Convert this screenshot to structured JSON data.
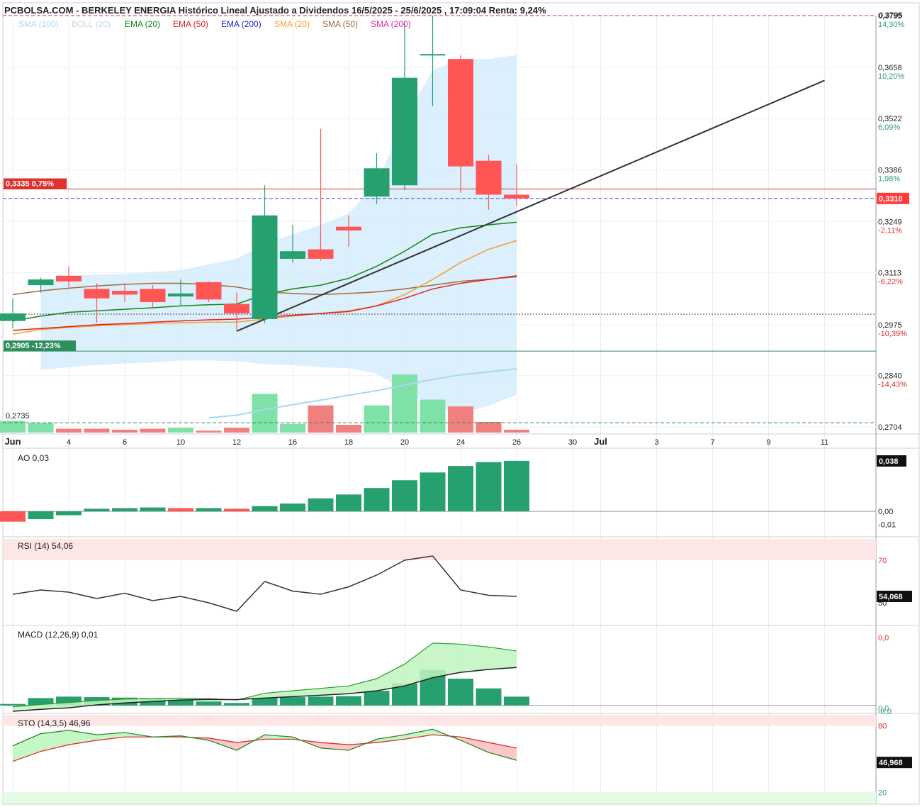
{
  "header": {
    "title": "PCBOLSA.COM - BERKELEY ENERGIA Histórico Lineal Ajustado a Dividendos 16/5/2025 - 25/6/2025 , 17:09:04 Renta: 9,24%",
    "top_tick_partial": "0,3795"
  },
  "legend": [
    {
      "label": "SMA (100)",
      "color": "#a8d8f0"
    },
    {
      "label": "BOLL (20)",
      "color": "#c8d8e8"
    },
    {
      "label": "EMA (20)",
      "color": "#118811"
    },
    {
      "label": "EMA (50)",
      "color": "#dd2222"
    },
    {
      "label": "EMA (200)",
      "color": "#2222cc"
    },
    {
      "label": "SMA (20)",
      "color": "#f0a030"
    },
    {
      "label": "SMA (50)",
      "color": "#a06a3a"
    },
    {
      "label": "SMA (200)",
      "color": "#ee22aa"
    }
  ],
  "colors": {
    "up": "#26a06e",
    "down": "#ff5555",
    "up_vol": "#7fe0a8",
    "down_vol": "#f08080",
    "trend": "#333333"
  },
  "chart_data": [
    {
      "type": "candlestick",
      "name": "price",
      "ylim": [
        0.2704,
        0.3795
      ],
      "y_ticks": [
        {
          "price": "0,3795",
          "pct": "14,30%",
          "v": 0.3795
        },
        {
          "price": "0,3658",
          "pct": "10,20%",
          "v": 0.3658
        },
        {
          "price": "0,3522",
          "pct": "6,09%",
          "v": 0.3522
        },
        {
          "price": "0,3386",
          "pct": "1,98%",
          "v": 0.3386
        },
        {
          "price": "0,3249",
          "pct": "-2,11%",
          "v": 0.3249
        },
        {
          "price": "0,3113",
          "pct": "-6,22%",
          "v": 0.3113
        },
        {
          "price": "0,2975",
          "pct": "-10,39%",
          "v": 0.2975
        },
        {
          "price": "0,2840",
          "pct": "-14,43%",
          "v": 0.284
        },
        {
          "price": "0,2704",
          "pct": "",
          "v": 0.2704
        }
      ],
      "x_ticks": [
        {
          "label": "30",
          "i": -1
        },
        {
          "label": "Jun",
          "i": 0
        },
        {
          "label": "4",
          "i": 2
        },
        {
          "label": "6",
          "i": 4
        },
        {
          "label": "10",
          "i": 6
        },
        {
          "label": "12",
          "i": 8
        },
        {
          "label": "16",
          "i": 10
        },
        {
          "label": "18",
          "i": 12
        },
        {
          "label": "20",
          "i": 14
        },
        {
          "label": "24",
          "i": 16
        },
        {
          "label": "26",
          "i": 18
        },
        {
          "label": "30",
          "i": 20
        },
        {
          "label": "Jul",
          "i": 21
        },
        {
          "label": "3",
          "i": 23
        },
        {
          "label": "7",
          "i": 25
        },
        {
          "label": "9",
          "i": 27
        },
        {
          "label": "11",
          "i": 29
        }
      ],
      "candles": [
        {
          "o": 0.2985,
          "h": 0.3045,
          "l": 0.2965,
          "c": 0.3005
        },
        {
          "o": 0.308,
          "h": 0.31,
          "l": 0.306,
          "c": 0.3095
        },
        {
          "o": 0.3105,
          "h": 0.313,
          "l": 0.3075,
          "c": 0.309
        },
        {
          "o": 0.307,
          "h": 0.3085,
          "l": 0.298,
          "c": 0.3045
        },
        {
          "o": 0.3065,
          "h": 0.3085,
          "l": 0.3035,
          "c": 0.3055
        },
        {
          "o": 0.307,
          "h": 0.308,
          "l": 0.302,
          "c": 0.3035
        },
        {
          "o": 0.305,
          "h": 0.3095,
          "l": 0.3025,
          "c": 0.3058
        },
        {
          "o": 0.3088,
          "h": 0.309,
          "l": 0.3035,
          "c": 0.3042
        },
        {
          "o": 0.303,
          "h": 0.306,
          "l": 0.296,
          "c": 0.3005
        },
        {
          "o": 0.299,
          "h": 0.3345,
          "l": 0.298,
          "c": 0.3265
        },
        {
          "o": 0.315,
          "h": 0.324,
          "l": 0.314,
          "c": 0.317
        },
        {
          "o": 0.3175,
          "h": 0.3495,
          "l": 0.3145,
          "c": 0.315
        },
        {
          "o": 0.3235,
          "h": 0.3265,
          "l": 0.3182,
          "c": 0.3225
        },
        {
          "o": 0.3315,
          "h": 0.343,
          "l": 0.3295,
          "c": 0.339
        },
        {
          "o": 0.3345,
          "h": 0.3775,
          "l": 0.3332,
          "c": 0.363
        },
        {
          "o": 0.369,
          "h": 0.3795,
          "l": 0.3555,
          "c": 0.3693
        },
        {
          "o": 0.368,
          "h": 0.369,
          "l": 0.3325,
          "c": 0.3395
        },
        {
          "o": 0.341,
          "h": 0.3425,
          "l": 0.328,
          "c": 0.332
        },
        {
          "o": 0.332,
          "h": 0.34,
          "l": 0.329,
          "c": 0.331
        }
      ],
      "volume": [
        12,
        10,
        4,
        4,
        3,
        4,
        5,
        2,
        5,
        40,
        9,
        28,
        8,
        28,
        60,
        34,
        27,
        11,
        3
      ],
      "sma100": [
        null,
        null,
        null,
        null,
        null,
        null,
        null,
        0.2728,
        0.2735,
        0.275,
        0.2763,
        0.2775,
        0.2788,
        0.28,
        0.2815,
        0.283,
        0.2842,
        0.285,
        0.2858
      ],
      "ema20": [
        0.2985,
        0.2998,
        0.3008,
        0.3012,
        0.3016,
        0.302,
        0.3025,
        0.3028,
        0.303,
        0.3055,
        0.307,
        0.308,
        0.3098,
        0.313,
        0.317,
        0.3215,
        0.3232,
        0.324,
        0.3247
      ],
      "ema50": [
        0.296,
        0.2965,
        0.297,
        0.2975,
        0.2978,
        0.2982,
        0.2985,
        0.2988,
        0.299,
        0.2995,
        0.3,
        0.3005,
        0.301,
        0.3025,
        0.3045,
        0.307,
        0.3085,
        0.3095,
        0.3105
      ],
      "sma20": [
        0.295,
        0.2962,
        0.2968,
        0.2972,
        0.2975,
        0.2978,
        0.298,
        0.2982,
        0.2982,
        0.299,
        0.2998,
        0.3005,
        0.3012,
        0.3025,
        0.3055,
        0.3095,
        0.314,
        0.3175,
        0.3198
      ],
      "sma50": [
        0.3055,
        0.3065,
        0.3072,
        0.3078,
        0.3082,
        0.3085,
        0.3085,
        0.3082,
        0.3075,
        0.3062,
        0.3058,
        0.3055,
        0.3058,
        0.3062,
        0.307,
        0.308,
        0.309,
        0.3096,
        0.3102
      ],
      "boll_upper": [
        null,
        0.309,
        0.3105,
        0.3108,
        0.311,
        0.3115,
        0.312,
        0.3135,
        0.315,
        0.319,
        0.3215,
        0.324,
        0.327,
        0.335,
        0.352,
        0.365,
        0.368,
        0.368,
        0.369
      ],
      "boll_lower": [
        null,
        0.2855,
        0.2862,
        0.2868,
        0.2872,
        0.2875,
        0.288,
        0.288,
        0.2878,
        0.287,
        0.2868,
        0.2862,
        0.286,
        0.2845,
        0.28,
        0.276,
        0.274,
        0.276,
        0.279
      ],
      "trendline": {
        "from": {
          "i": 8,
          "v": 0.2958
        },
        "to": {
          "i": 29,
          "v": 0.3623
        }
      },
      "price_lines": [
        {
          "value": 0.3335,
          "label": "0,3335  0,75%",
          "color": "#e03030"
        },
        {
          "value": 0.331,
          "label": "0,3310",
          "color": "#2244dd",
          "style": "dashed"
        },
        {
          "value": 0.3003,
          "color": "#444444",
          "style": "dotted"
        },
        {
          "value": 0.2905,
          "label": "0,2905  -12,23%",
          "color": "#2f8f5f"
        },
        {
          "value": 0.2715,
          "color": "#2f8f5f",
          "style": "dashed"
        },
        {
          "value": 0.3795,
          "color": "#e03030",
          "style": "dashed"
        }
      ],
      "low_label": "0,2735",
      "last_price_badge": "0,3310"
    },
    {
      "type": "bar",
      "name": "AO",
      "title": "AO   0,03",
      "ylim": [
        -0.012,
        0.04
      ],
      "y_ticks": [
        {
          "label": "0,00",
          "v": 0.0
        },
        {
          "label": "-0,01",
          "v": -0.01
        }
      ],
      "last_badge": "0,038",
      "values": [
        -0.008,
        -0.006,
        -0.003,
        0.002,
        0.0025,
        0.003,
        0.0025,
        0.0025,
        0.002,
        0.004,
        0.006,
        0.01,
        0.013,
        0.018,
        0.024,
        0.03,
        0.035,
        0.038,
        0.039
      ],
      "colors": [
        "down",
        "up",
        "up",
        "up",
        "up",
        "up",
        "down",
        "up",
        "down",
        "up",
        "up",
        "up",
        "up",
        "up",
        "up",
        "up",
        "up",
        "up",
        "up"
      ]
    },
    {
      "type": "line",
      "name": "RSI",
      "title": "RSI (14)   54,06",
      "ylim": [
        40,
        80
      ],
      "band_from": 70,
      "y_ticks": [
        {
          "label": "70",
          "v": 70
        },
        {
          "label": "50",
          "v": 50
        }
      ],
      "last_badge": "54,068",
      "values": [
        54,
        56,
        55,
        52,
        54.5,
        51,
        53,
        50,
        46,
        60,
        55.5,
        54,
        57.5,
        63,
        70,
        72,
        56,
        53.5,
        53
      ]
    },
    {
      "type": "bar",
      "name": "MACD",
      "title": "MACD (12,26,9)   0,01",
      "ylim": [
        -0.0015,
        0.016
      ],
      "y_ticks": [
        {
          "label": "0,0",
          "v": 0.0
        },
        {
          "label": "-0,0",
          "v": -0.0006
        }
      ],
      "top_label": "0,0",
      "histogram": [
        0.0003,
        0.0015,
        0.0018,
        0.0017,
        0.0016,
        0.0015,
        0.0013,
        0.0008,
        0.0005,
        0.0015,
        0.0017,
        0.0018,
        0.0019,
        0.003,
        0.0045,
        0.0073,
        0.0055,
        0.0035,
        0.0018
      ],
      "macd": [
        -0.0003,
        0.0002,
        0.0006,
        0.001,
        0.0013,
        0.0014,
        0.0015,
        0.0014,
        0.0011,
        0.0025,
        0.003,
        0.0035,
        0.004,
        0.0055,
        0.0085,
        0.0128,
        0.0126,
        0.012,
        0.0112
      ],
      "signal": [
        -0.0012,
        -0.0008,
        -0.0005,
        0.0001,
        0.0005,
        0.0008,
        0.0011,
        0.0012,
        0.0012,
        0.0015,
        0.0018,
        0.0021,
        0.0024,
        0.003,
        0.004,
        0.0057,
        0.0068,
        0.0074,
        0.0078
      ]
    },
    {
      "type": "line",
      "name": "STO",
      "title": "STO (14,3,5)   46,96",
      "ylim": [
        10,
        90
      ],
      "band_top_from": 80,
      "band_bottom_to": 20,
      "y_ticks": [
        {
          "label": "80",
          "v": 80
        },
        {
          "label": "20",
          "v": 20
        }
      ],
      "last_badge": "46,968",
      "k": [
        62,
        73,
        76,
        72,
        74,
        70,
        71,
        67,
        58,
        72,
        70,
        60,
        58,
        68,
        72,
        77,
        67,
        56,
        49
      ],
      "d": [
        48,
        57,
        63,
        67,
        70,
        70,
        70,
        69,
        65,
        68,
        68,
        65,
        63,
        65,
        68,
        72,
        70,
        65,
        60
      ]
    }
  ]
}
